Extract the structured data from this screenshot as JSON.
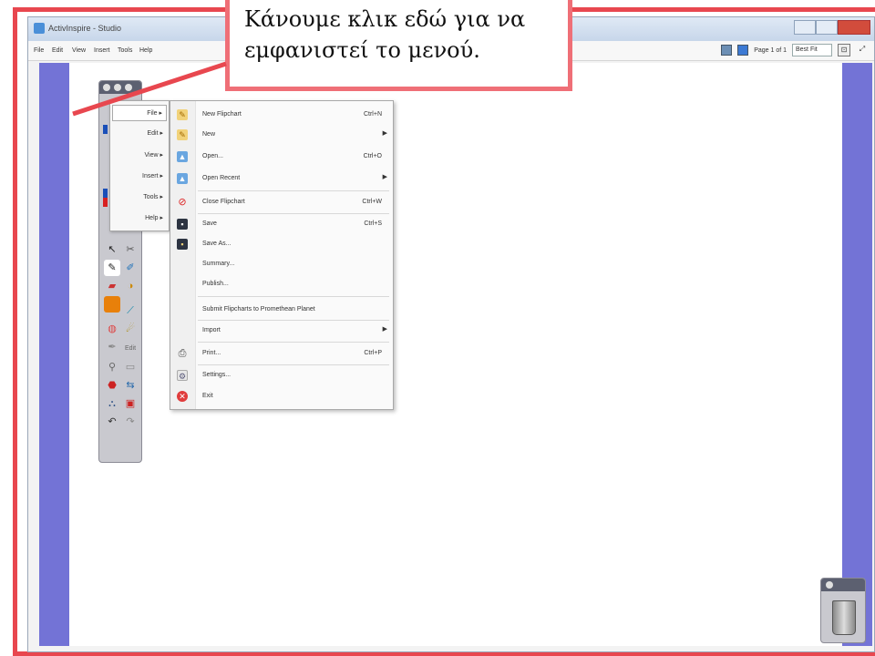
{
  "window": {
    "title": "ActivInspire - Studio",
    "controls": [
      "",
      "",
      ""
    ]
  },
  "menubar": {
    "items": [
      "File",
      "Edit",
      "View",
      "Insert",
      "Tools",
      "Help"
    ],
    "page_label": "Page 1 of 1",
    "zoom": "Best Fit"
  },
  "main_menu": {
    "items": [
      "File",
      "Edit",
      "View",
      "Insert",
      "Tools",
      "Help"
    ]
  },
  "file_menu": {
    "items": [
      {
        "label": "New Flipchart",
        "shortcut": "Ctrl+N",
        "icon": "new-flipchart-icon"
      },
      {
        "label": "New",
        "shortcut": "",
        "icon": "new-icon",
        "submenu": true
      },
      {
        "label": "Open...",
        "shortcut": "Ctrl+O",
        "icon": "open-icon"
      },
      {
        "label": "Open Recent",
        "shortcut": "",
        "icon": "open-recent-icon",
        "submenu": true
      },
      {
        "label": "Close Flipchart",
        "shortcut": "Ctrl+W",
        "icon": "close-flipchart-icon"
      },
      {
        "label": "Save",
        "shortcut": "Ctrl+S",
        "icon": "save-icon"
      },
      {
        "label": "Save As...",
        "shortcut": "",
        "icon": "save-as-icon"
      },
      {
        "label": "Summary...",
        "shortcut": "",
        "icon": ""
      },
      {
        "label": "Publish...",
        "shortcut": "",
        "icon": ""
      },
      {
        "label": "Submit Flipcharts to Promethean Planet",
        "shortcut": "",
        "icon": ""
      },
      {
        "label": "Import",
        "shortcut": "",
        "icon": "",
        "submenu": true
      },
      {
        "label": "Print...",
        "shortcut": "Ctrl+P",
        "icon": "print-icon"
      },
      {
        "label": "Settings...",
        "shortcut": "",
        "icon": "settings-icon"
      },
      {
        "label": "Exit",
        "shortcut": "",
        "icon": "exit-icon"
      }
    ]
  },
  "callout": {
    "line1": "Κάνουμε κλικ εδώ για να",
    "line2": "εμφανιστεί το μενού."
  },
  "colors": {
    "annotation_red": "#e8474f",
    "workspace_purple": "#7373d6"
  }
}
